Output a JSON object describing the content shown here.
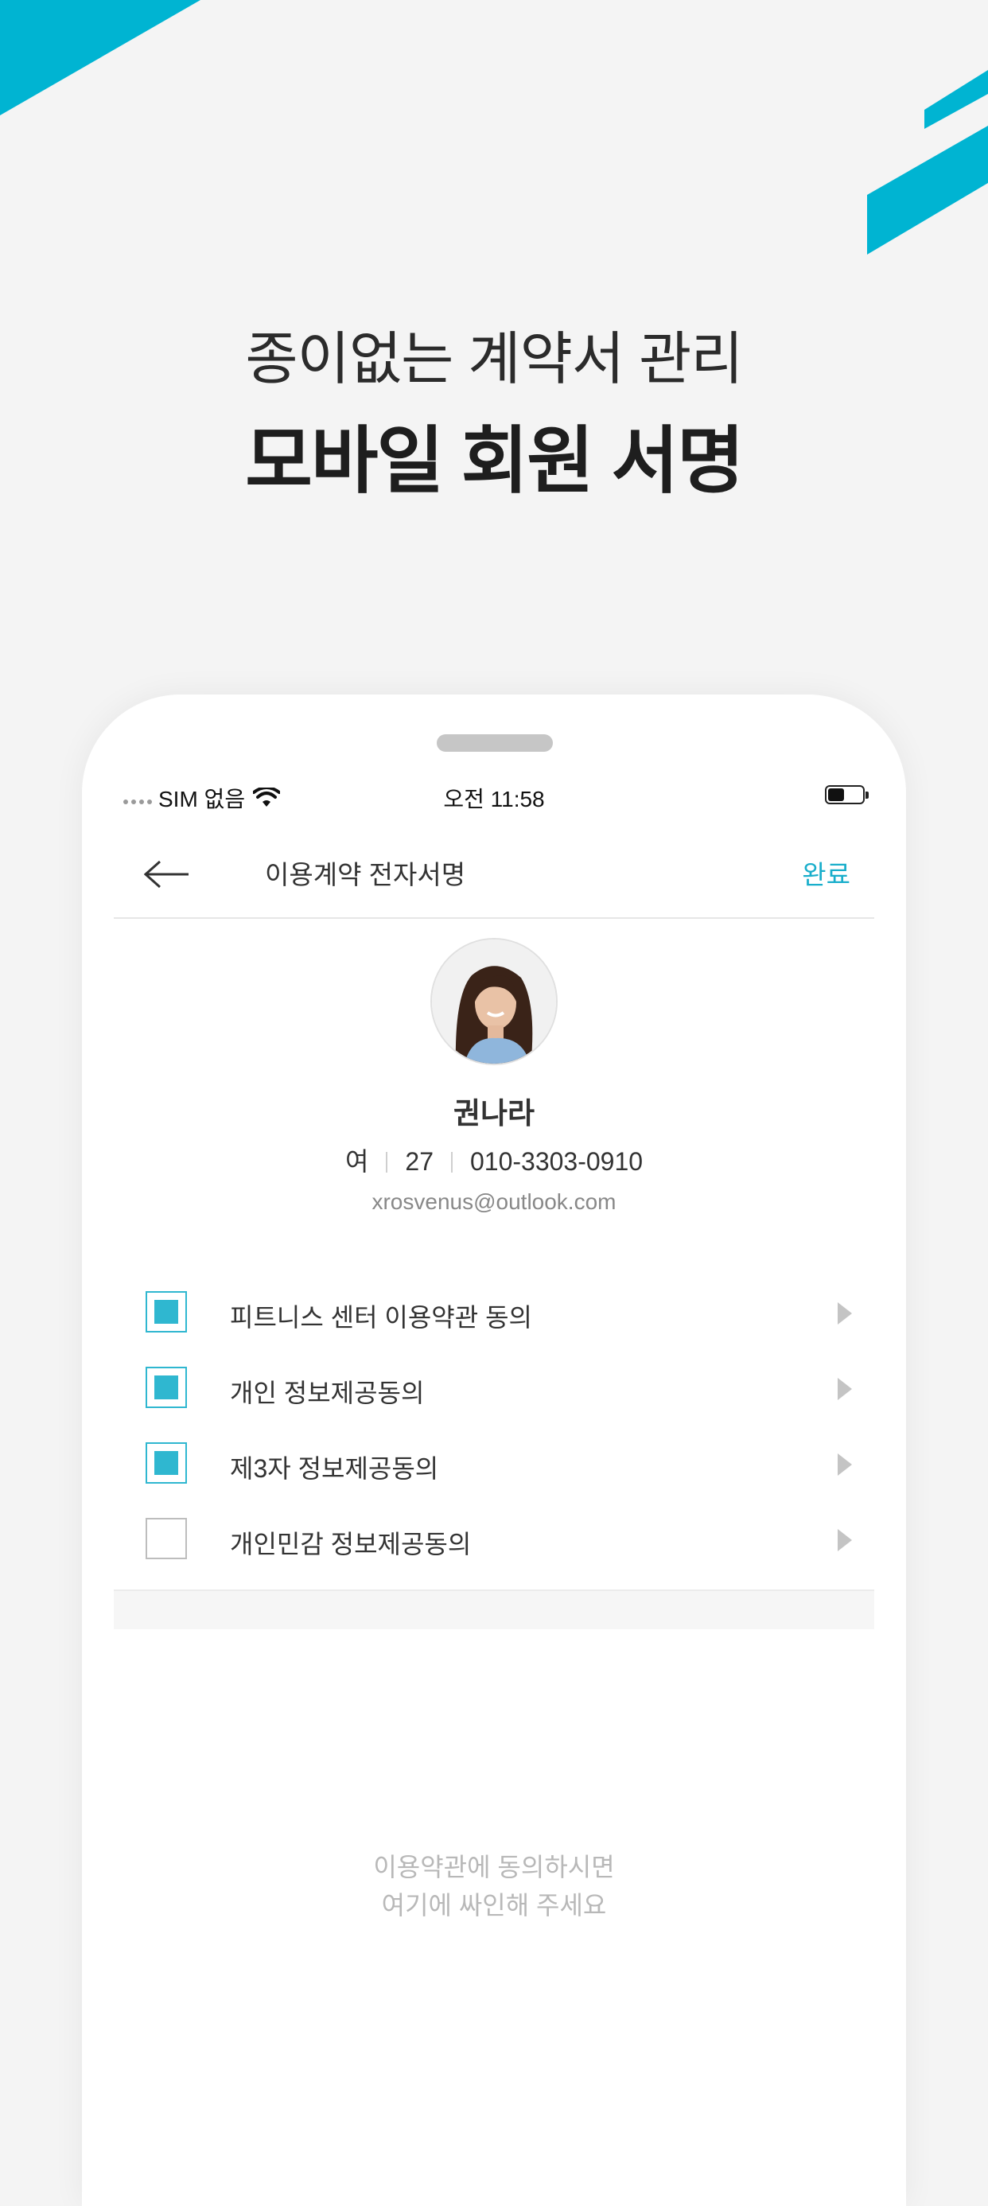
{
  "colors": {
    "accent": "#19aecb",
    "checkbox": "#2fb7d0",
    "background": "#f4f4f4"
  },
  "headline": {
    "subtitle": "종이없는 계약서 관리",
    "title": "모바일 회원 서명"
  },
  "status_bar": {
    "carrier": "SIM 없음",
    "time": "오전 11:58",
    "battery_level": 0.45
  },
  "nav": {
    "back_icon": "back-arrow-icon",
    "title": "이용계약 전자서명",
    "done_label": "완료"
  },
  "member": {
    "name": "권나라",
    "gender": "여",
    "age": "27",
    "phone": "010-3303-0910",
    "email": "xrosvenus@outlook.com"
  },
  "agreements": [
    {
      "label": "피트니스 센터 이용약관 동의",
      "checked": true
    },
    {
      "label": "개인 정보제공동의",
      "checked": true
    },
    {
      "label": "제3자 정보제공동의",
      "checked": true
    },
    {
      "label": "개인민감 정보제공동의",
      "checked": false
    }
  ],
  "signature": {
    "hint_line1": "이용약관에 동의하시면",
    "hint_line2": "여기에 싸인해 주세요"
  }
}
